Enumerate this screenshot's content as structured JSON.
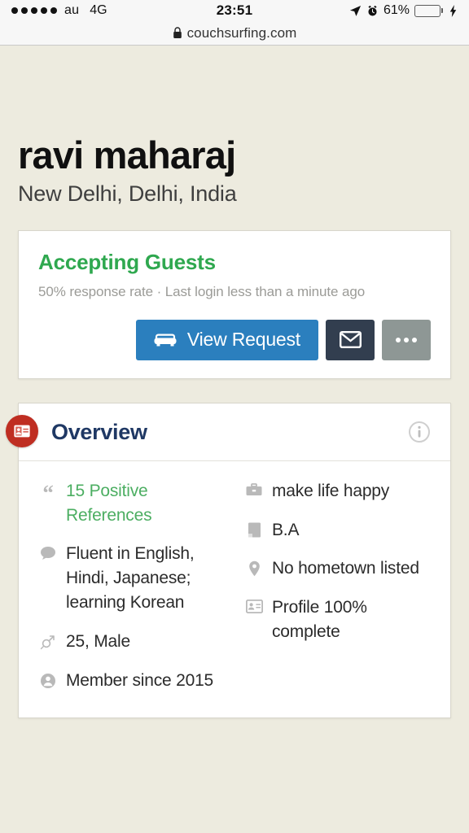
{
  "status_bar": {
    "signal_dots": 5,
    "carrier": "au",
    "network": "4G",
    "time": "23:51",
    "battery_percent": "61%",
    "battery_level": 61,
    "charging": true,
    "location_icon": "location-arrow-icon",
    "alarm_icon": "alarm-clock-icon"
  },
  "browser": {
    "lock_icon": "lock-icon",
    "url": "couchsurfing.com"
  },
  "profile": {
    "name": "ravi maharaj",
    "location": "New Delhi, Delhi, India"
  },
  "status_card": {
    "headline": "Accepting Guests",
    "headline_color": "#2fa84f",
    "subtext": "50% response rate · Last login less than a minute ago",
    "buttons": {
      "request_label": "View Request",
      "request_icon": "couch-icon",
      "request_color": "#2b7fbe",
      "message_icon": "envelope-icon",
      "message_color": "#323e4f",
      "more_icon": "ellipsis-icon",
      "more_color": "#8e9795"
    }
  },
  "overview": {
    "badge_icon": "id-card-icon",
    "badge_color": "#bf2e22",
    "title": "Overview",
    "title_color": "#1f3864",
    "info_icon": "info-circle-icon",
    "left_items": [
      {
        "icon": "quote-icon",
        "text": "15 Positive References",
        "link": true
      },
      {
        "icon": "comment-icon",
        "text": "Fluent in English, Hindi, Japanese; learning Korean",
        "link": false
      },
      {
        "icon": "gender-icon",
        "text": "25, Male",
        "link": false
      },
      {
        "icon": "member-icon",
        "text": "Member since 2015",
        "link": false
      }
    ],
    "right_items": [
      {
        "icon": "briefcase-icon",
        "text": "make life happy"
      },
      {
        "icon": "book-icon",
        "text": "B.A"
      },
      {
        "icon": "map-pin-icon",
        "text": "No hometown listed"
      },
      {
        "icon": "id-card-icon",
        "text": "Profile 100% complete"
      }
    ]
  }
}
